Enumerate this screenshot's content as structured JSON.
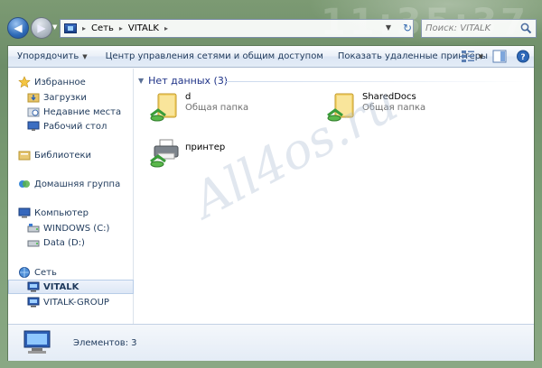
{
  "window": {
    "clock_ghost": "11:35:37"
  },
  "address_bar": {
    "segments": [
      "Сеть",
      "VITALK"
    ]
  },
  "search": {
    "placeholder": "Поиск: VITALK"
  },
  "toolbar": {
    "organize": "Упорядочить",
    "network_center": "Центр управления сетями и общим доступом",
    "show_printers": "Показать удаленные принтеры"
  },
  "sidebar": {
    "items": [
      {
        "label": "Избранное",
        "icon": "star-icon"
      },
      {
        "label": "Загрузки",
        "icon": "downloads-folder-icon"
      },
      {
        "label": "Недавние места",
        "icon": "recent-places-icon"
      },
      {
        "label": "Рабочий стол",
        "icon": "desktop-icon"
      },
      {
        "label": "Библиотеки",
        "icon": "libraries-icon"
      },
      {
        "label": "Домашняя группа",
        "icon": "homegroup-icon"
      },
      {
        "label": "Компьютер",
        "icon": "computer-icon"
      },
      {
        "label": "WINDOWS (C:)",
        "icon": "drive-icon"
      },
      {
        "label": "Data (D:)",
        "icon": "drive-icon"
      },
      {
        "label": "Сеть",
        "icon": "network-icon"
      },
      {
        "label": "VITALK",
        "icon": "network-computer-icon"
      },
      {
        "label": "VITALK-GROUP",
        "icon": "network-computer-icon"
      }
    ]
  },
  "content": {
    "group_header": "Нет данных (3)",
    "tiles": [
      {
        "name": "d",
        "subtitle": "Общая папка",
        "icon": "shared-folder-icon"
      },
      {
        "name": "SharedDocs",
        "subtitle": "Общая папка",
        "icon": "shared-folder-icon"
      },
      {
        "name": "принтер",
        "subtitle": "",
        "icon": "shared-printer-icon"
      }
    ]
  },
  "statusbar": {
    "text": "Элементов: 3"
  },
  "watermark": "All4os.ru",
  "colors": {
    "accent": "#1e3287",
    "text": "#1e395b",
    "selection": "#dde7f5"
  }
}
